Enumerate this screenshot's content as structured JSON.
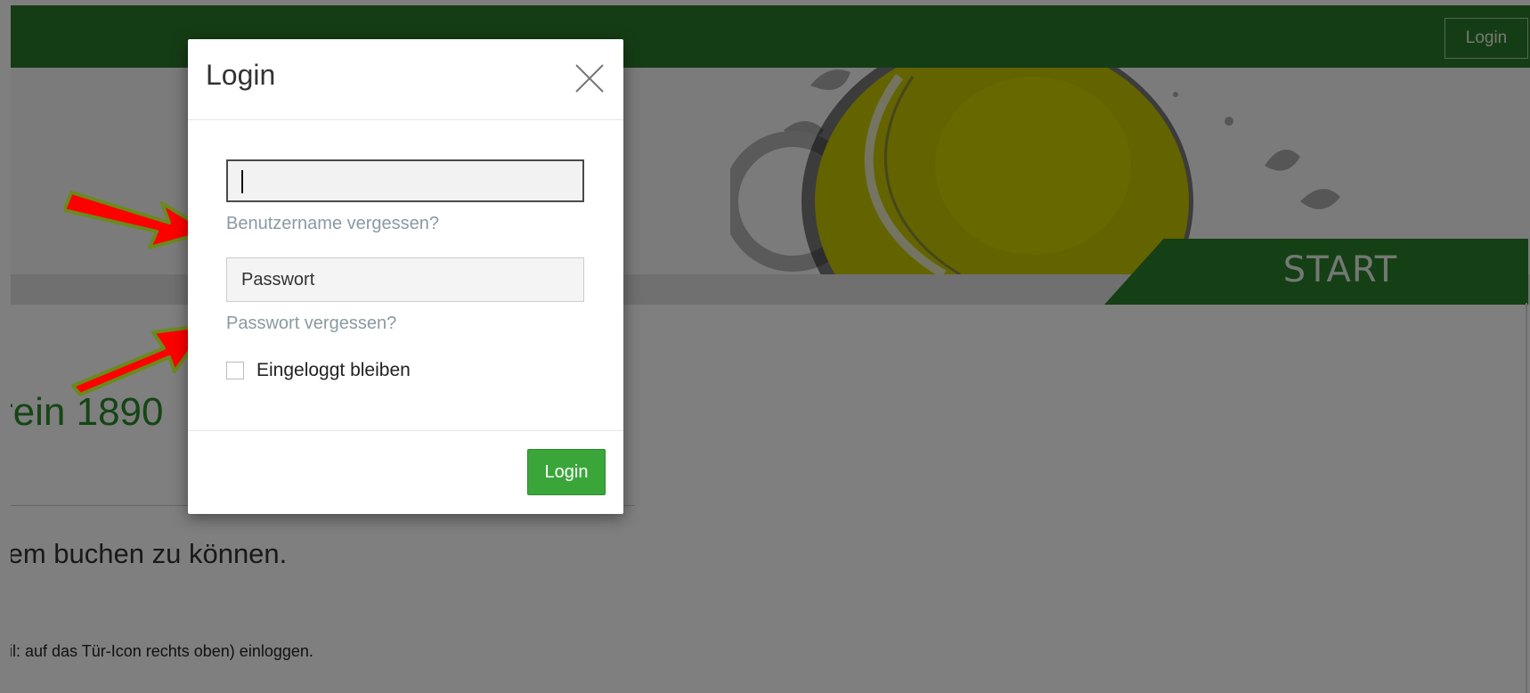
{
  "nav": {
    "login_label": "Login"
  },
  "hero": {
    "tab_label": "START"
  },
  "content": {
    "title_fragment": "rein 1890",
    "text_fragment": "tem buchen zu können.",
    "hint_fragment": "bil: auf das Tür-Icon rechts oben) einloggen."
  },
  "modal": {
    "title": "Login",
    "username_value": "",
    "forgot_username": "Benutzername vergessen?",
    "password_placeholder": "Passwort",
    "forgot_password": "Passwort vergessen?",
    "remember_label": "Eingeloggt bleiben",
    "remember_checked": false,
    "submit_label": "Login"
  },
  "colors": {
    "brand_green": "#2a7a2a",
    "button_green": "#3aa63a",
    "link_gray": "#8a9aa2",
    "annotation_arrow": "#ff0000"
  },
  "icons": {
    "close": "close-icon"
  }
}
